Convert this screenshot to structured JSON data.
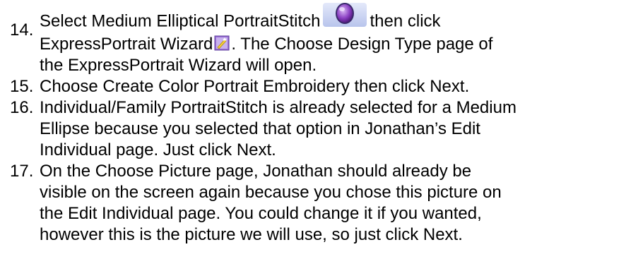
{
  "steps": [
    {
      "number": "14.",
      "line1_a": "Select Medium Elliptical PortraitStitch",
      "line1_icon": "medium-elliptical-portraitstitch-icon",
      "line1_b": "then click",
      "line2_a": "ExpressPortrait Wizard",
      "line2_icon": "expressportrait-wizard-icon",
      "line2_b": ". The Choose Design Type page of",
      "line3": "the ExpressPortrait Wizard will open."
    },
    {
      "number": "15.",
      "line1": "Choose Create Color Portrait Embroidery then click Next."
    },
    {
      "number": "16.",
      "line1": "Individual/Family PortraitStitch is already selected for a Medium",
      "line2": "Ellipse because you selected that option in Jonathan’s Edit",
      "line3": "Individual page. Just click Next."
    },
    {
      "number": "17.",
      "line1": "On the Choose Picture page, Jonathan should already be",
      "line2": "visible on the screen again because you chose this picture on",
      "line3": "the Edit Individual page.  You could change it if you wanted,",
      "line4": "however this is the picture we will use, so just click Next."
    }
  ],
  "colors": {
    "ellipse_button_bg": "#c9d3f2",
    "ellipse_purple": "#7a2fb0",
    "wizard_icon_purple": "#9b6fd6",
    "wizard_icon_yellow": "#f5d23a"
  }
}
